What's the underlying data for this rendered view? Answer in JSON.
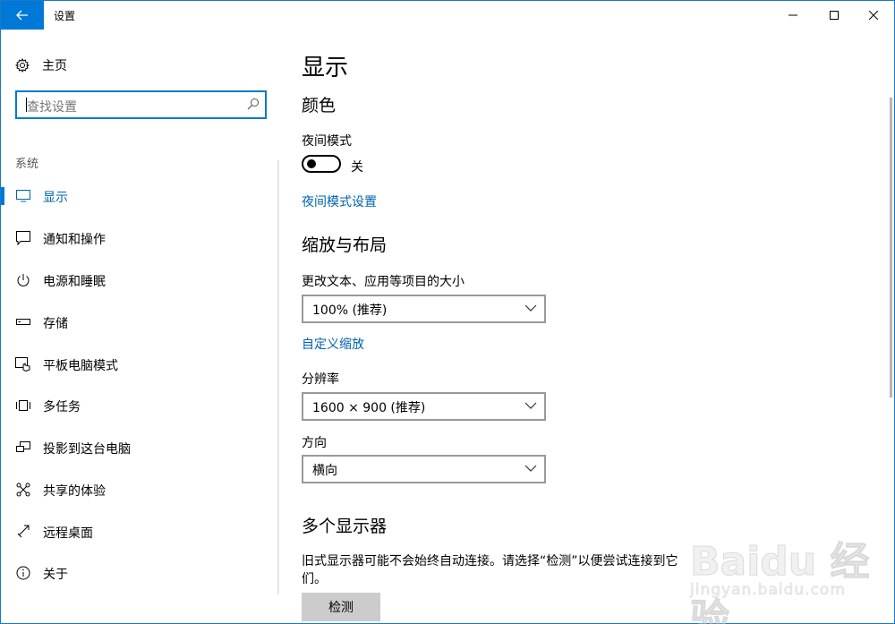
{
  "window": {
    "title": "设置"
  },
  "sidebar": {
    "home_label": "主页",
    "search_placeholder": "查找设置",
    "section_label": "系统",
    "items": [
      {
        "label": "显示",
        "icon": "monitor-icon",
        "active": true
      },
      {
        "label": "通知和操作",
        "icon": "notification-icon",
        "active": false
      },
      {
        "label": "电源和睡眠",
        "icon": "power-icon",
        "active": false
      },
      {
        "label": "存储",
        "icon": "storage-icon",
        "active": false
      },
      {
        "label": "平板电脑模式",
        "icon": "tablet-mode-icon",
        "active": false
      },
      {
        "label": "多任务",
        "icon": "multitask-icon",
        "active": false
      },
      {
        "label": "投影到这台电脑",
        "icon": "project-icon",
        "active": false
      },
      {
        "label": "共享的体验",
        "icon": "shared-experience-icon",
        "active": false
      },
      {
        "label": "远程桌面",
        "icon": "remote-desktop-icon",
        "active": false
      },
      {
        "label": "关于",
        "icon": "info-icon",
        "active": false
      }
    ]
  },
  "main": {
    "page_title": "显示",
    "color_heading": "颜色",
    "night_mode_label": "夜间模式",
    "night_mode_state": "关",
    "night_mode_settings_link": "夜间模式设置",
    "scale_heading": "缩放与布局",
    "scale_label": "更改文本、应用等项目的大小",
    "scale_value": "100% (推荐)",
    "custom_scale_link": "自定义缩放",
    "resolution_label": "分辨率",
    "resolution_value": "1600 × 900 (推荐)",
    "orientation_label": "方向",
    "orientation_value": "横向",
    "multi_display_heading": "多个显示器",
    "multi_display_text": "旧式显示器可能不会始终自动连接。请选择“检测”以便尝试连接到它们。",
    "detect_button": "检测"
  },
  "watermark": {
    "brand": "Baidu 经验",
    "url": "jingyan.baidu.com"
  },
  "colors": {
    "accent": "#0078d7",
    "link": "#0063b1"
  }
}
